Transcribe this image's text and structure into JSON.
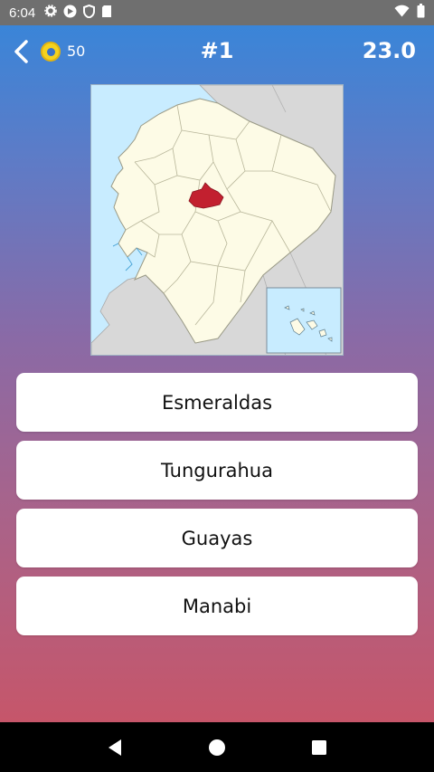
{
  "status_bar": {
    "time": "6:04",
    "left_icons": [
      "settings-icon",
      "sync-icon",
      "shield-icon",
      "sd-card-icon"
    ],
    "right_icons": [
      "wifi-icon",
      "battery-icon"
    ]
  },
  "top_bar": {
    "back_icon": "chevron-left-icon",
    "coin_icon": "coin-icon",
    "coins": "50",
    "question_number": "#1",
    "timer": "23.0"
  },
  "map": {
    "description_icon": "ecuador-province-map",
    "highlight_color": "#c2202f",
    "land_color": "#fdfbe6",
    "sea_color": "#c8ecff",
    "neighbor_color": "#d8d8d8"
  },
  "answers": [
    {
      "label": "Esmeraldas"
    },
    {
      "label": "Tungurahua"
    },
    {
      "label": "Guayas"
    },
    {
      "label": "Manabi"
    }
  ],
  "nav_bar": {
    "back_icon": "triangle-back-icon",
    "home_icon": "circle-home-icon",
    "recents_icon": "square-recents-icon"
  },
  "colors": {
    "gradient_top": "#3a85d8",
    "gradient_bottom": "#c6566a",
    "status_bar": "#6f6f6f"
  }
}
